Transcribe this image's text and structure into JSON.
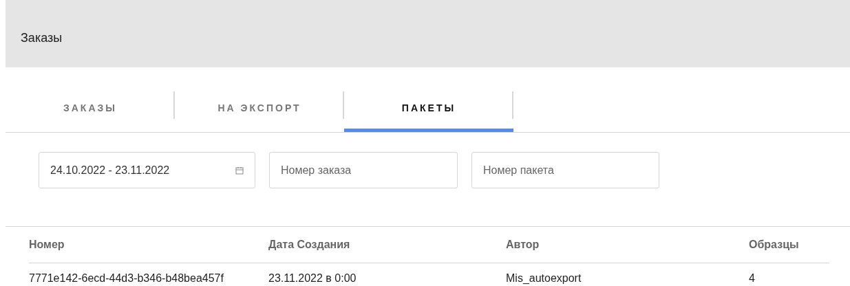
{
  "header": {
    "title": "Заказы"
  },
  "tabs": [
    {
      "label": "ЗАКАЗЫ",
      "selected": false
    },
    {
      "label": "НА ЭКСПОРТ",
      "selected": false
    },
    {
      "label": "ПАКЕТЫ",
      "selected": true
    }
  ],
  "filters": {
    "date_range": {
      "value": "24.10.2022 - 23.11.2022"
    },
    "order_number": {
      "placeholder": "Номер заказа"
    },
    "package_number": {
      "placeholder": "Номер пакета"
    }
  },
  "table": {
    "columns": [
      "Номер",
      "Дата Создания",
      "Автор",
      "Образцы"
    ],
    "rows": [
      [
        "7771e142-6ecd-44d3-b346-b48bea457f",
        "23.11.2022 в 0:00",
        "Mis_autoexport",
        "4"
      ]
    ]
  }
}
